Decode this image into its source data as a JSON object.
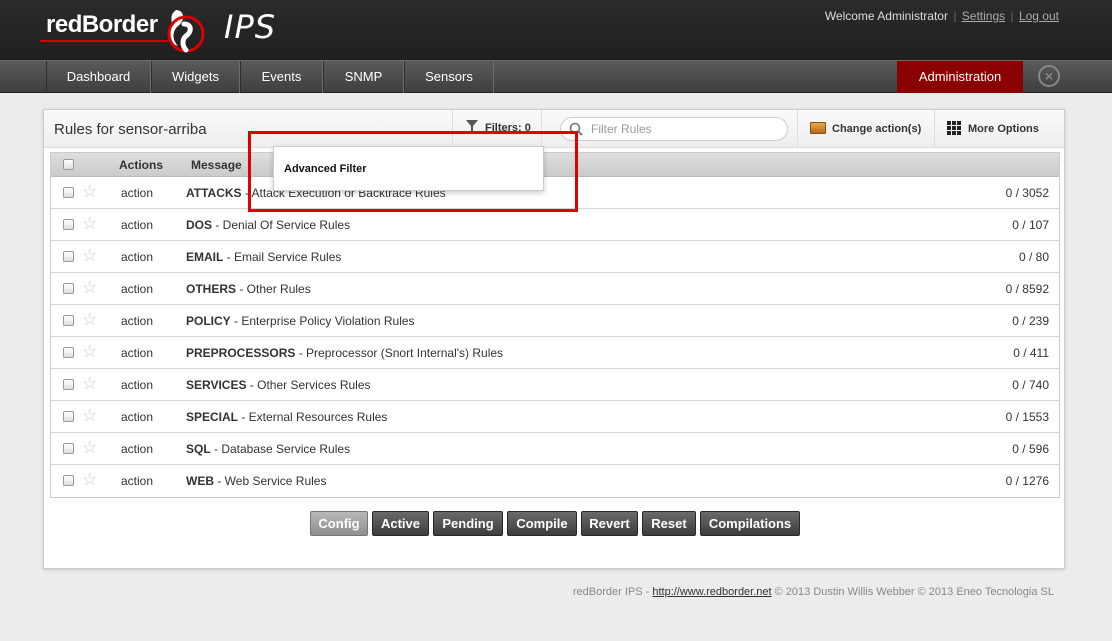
{
  "header": {
    "logo_text": "redBorder",
    "product": "IPS",
    "welcome": "Welcome Administrator",
    "settings_link": "Settings",
    "logout_link": "Log out"
  },
  "nav": {
    "items": [
      "Dashboard",
      "Widgets",
      "Events",
      "SNMP",
      "Sensors"
    ],
    "admin": "Administration",
    "close_icon": "close-icon"
  },
  "panel": {
    "title": "Rules for sensor-arriba",
    "filters_label": "Filters: 0",
    "search_placeholder": "Filter Rules",
    "change_actions": "Change action(s)",
    "more_options": "More Options"
  },
  "table": {
    "headers": {
      "actions": "Actions",
      "message": "Message"
    },
    "rows": [
      {
        "action": "action",
        "category": "ATTACKS",
        "desc": " - Attack Execution or Backtrace Rules",
        "count": "0 / 3052"
      },
      {
        "action": "action",
        "category": "DOS",
        "desc": " - Denial Of Service Rules",
        "count": "0 / 107"
      },
      {
        "action": "action",
        "category": "EMAIL",
        "desc": " - Email Service Rules",
        "count": "0 / 80"
      },
      {
        "action": "action",
        "category": "OTHERS",
        "desc": " - Other Rules",
        "count": "0 / 8592"
      },
      {
        "action": "action",
        "category": "POLICY",
        "desc": " - Enterprise Policy Violation Rules",
        "count": "0 / 239"
      },
      {
        "action": "action",
        "category": "PREPROCESSORS",
        "desc": " - Preprocessor (Snort Internal's) Rules",
        "count": "0 / 411"
      },
      {
        "action": "action",
        "category": "SERVICES",
        "desc": " - Other Services Rules",
        "count": "0 / 740"
      },
      {
        "action": "action",
        "category": "SPECIAL",
        "desc": " - External Resources Rules",
        "count": "0 / 1553"
      },
      {
        "action": "action",
        "category": "SQL",
        "desc": " - Database Service Rules",
        "count": "0 / 596"
      },
      {
        "action": "action",
        "category": "WEB",
        "desc": " - Web Service Rules",
        "count": "0 / 1276"
      }
    ]
  },
  "dropdown": {
    "item": "Advanced Filter"
  },
  "buttons": [
    "Config",
    "Active",
    "Pending",
    "Compile",
    "Revert",
    "Reset",
    "Compilations"
  ],
  "footer": {
    "prefix": "redBorder IPS - ",
    "link": "http://www.redborder.net",
    "suffix": " © 2013 Dustin Willis Webber © 2013 Eneo Tecnologia SL"
  }
}
